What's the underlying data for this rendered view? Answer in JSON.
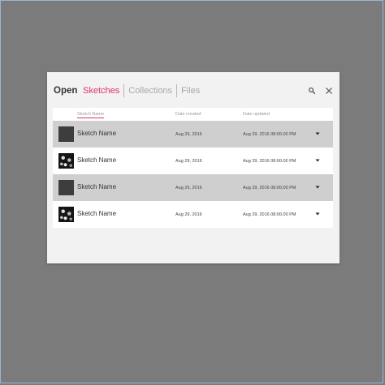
{
  "dialog": {
    "title": "Open",
    "tabs": [
      {
        "label": "Sketches",
        "active": true
      },
      {
        "label": "Collections",
        "active": false
      },
      {
        "label": "Files",
        "active": false
      }
    ],
    "icons": {
      "search": "search-icon",
      "close": "close-icon"
    },
    "accent_color": "#e0306a"
  },
  "table": {
    "columns": [
      "Sketch Name",
      "Date created",
      "Date updated"
    ],
    "rows": [
      {
        "name": "Sketch Name",
        "created": "Aug 29, 2016",
        "updated": "Aug 29, 2016 08:00.00 PM",
        "thumbnail": "dark",
        "selected": true
      },
      {
        "name": "Sketch Name",
        "created": "Aug 29, 2016",
        "updated": "Aug 29, 2016 08:00.00 PM",
        "thumbnail": "pattern",
        "selected": false
      },
      {
        "name": "Sketch Name",
        "created": "Aug 29, 2016",
        "updated": "Aug 29, 2016 08:00.00 PM",
        "thumbnail": "dark",
        "selected": true
      },
      {
        "name": "Sketch Name",
        "created": "Aug 29, 2016",
        "updated": "Aug 29, 2016 08:00.00 PM",
        "thumbnail": "pattern",
        "selected": false
      }
    ]
  }
}
